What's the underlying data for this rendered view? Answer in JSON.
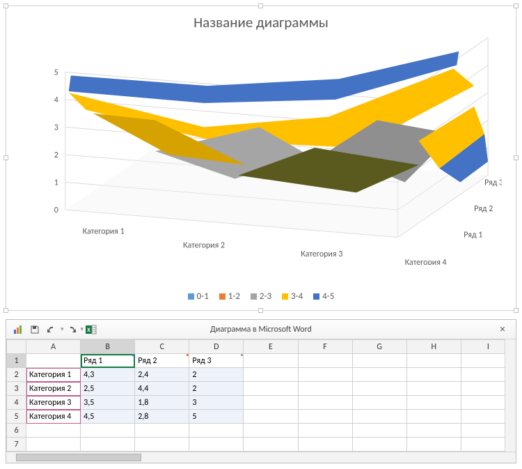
{
  "chart_data": {
    "type": "area",
    "title": "Название диаграммы",
    "categories": [
      "Категория 1",
      "Категория 2",
      "Категория 3",
      "Категория 4"
    ],
    "series": [
      {
        "name": "Ряд 1",
        "values": [
          4.3,
          2.5,
          3.5,
          4.5
        ]
      },
      {
        "name": "Ряд 2",
        "values": [
          2.4,
          4.4,
          1.8,
          2.8
        ]
      },
      {
        "name": "Ряд 3",
        "values": [
          2,
          2,
          3,
          5
        ]
      }
    ],
    "z_ticks": [
      0,
      1,
      2,
      3,
      4,
      5
    ],
    "legend": [
      "0-1",
      "1-2",
      "2-3",
      "3-4",
      "4-5"
    ],
    "legend_colors": [
      "#5b9bd5",
      "#ed7d31",
      "#a5a5a5",
      "#ffc000",
      "#4472c4"
    ]
  },
  "datasheet": {
    "title": "Диаграмма в Microsoft Word",
    "columns": [
      "A",
      "B",
      "C",
      "D",
      "E",
      "F",
      "G",
      "H",
      "I"
    ],
    "rows": [
      "1",
      "2",
      "3",
      "4",
      "5",
      "6",
      "7"
    ],
    "headers": {
      "B1": "Ряд 1",
      "C1": "Ряд 2",
      "D1": "Ряд 3"
    },
    "body": {
      "A2": "Категория 1",
      "B2": "4,3",
      "C2": "2,4",
      "D2": "2",
      "A3": "Категория 2",
      "B3": "2,5",
      "C3": "4,4",
      "D3": "2",
      "A4": "Категория 3",
      "B4": "3,5",
      "C4": "1,8",
      "D4": "3",
      "A5": "Категория 4",
      "B5": "4,5",
      "C5": "2,8",
      "D5": "5"
    },
    "active_cell": "B1",
    "selected_col": "B"
  },
  "toolbar": {
    "save": "Сохранить",
    "undo": "Отменить",
    "redo": "Вернуть",
    "edit_data": "Изменить данные"
  }
}
